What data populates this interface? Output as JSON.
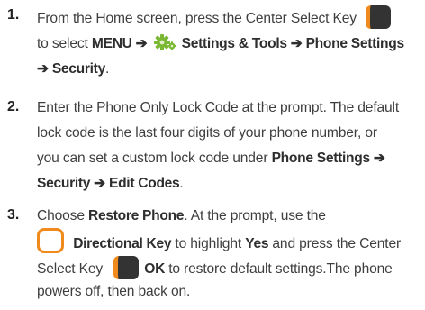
{
  "steps": [
    {
      "number": "1.",
      "l1_text": "From the Home screen, press the Center Select Key",
      "l2_a": "to select ",
      "l2_menu": "MENU",
      "l2_arrow": " ➔ ",
      "l2_settings": "Settings & Tools",
      "l2_arrow2": " ➔ ",
      "l2_phone": "Phone Settings",
      "l3_arrow": "➔ ",
      "l3_security": "Security",
      "l3_period": "."
    },
    {
      "number": "2.",
      "l1": "Enter the Phone Only Lock Code at the prompt. The default",
      "l2": "lock code is the last four digits of your phone number, or",
      "l3_a": "you can set a custom lock code under ",
      "l3_b": "Phone Settings ➔",
      "l4_b": "Security ➔ Edit Codes",
      "l4_end": "."
    },
    {
      "number": "3.",
      "l1_a": "Choose ",
      "l1_b": "Restore Phone",
      "l1_c": ". At the prompt, use the",
      "l2_b1": "Directional Key",
      "l2_a": " to highlight ",
      "l2_b2": "Yes",
      "l2_c": " and press the Center",
      "l3_a": "Select Key",
      "l3_b": "OK",
      "l3_c": " to restore default settings.The phone",
      "l4": "powers off, then back on."
    }
  ],
  "icons": {
    "select_key": "center-select-key-icon",
    "settings_gear": "settings-gear-icon",
    "directional_key": "directional-key-icon"
  },
  "colors": {
    "key_orange": "#f08a1c",
    "key_dark": "#333333",
    "gear_green": "#7ab833"
  }
}
